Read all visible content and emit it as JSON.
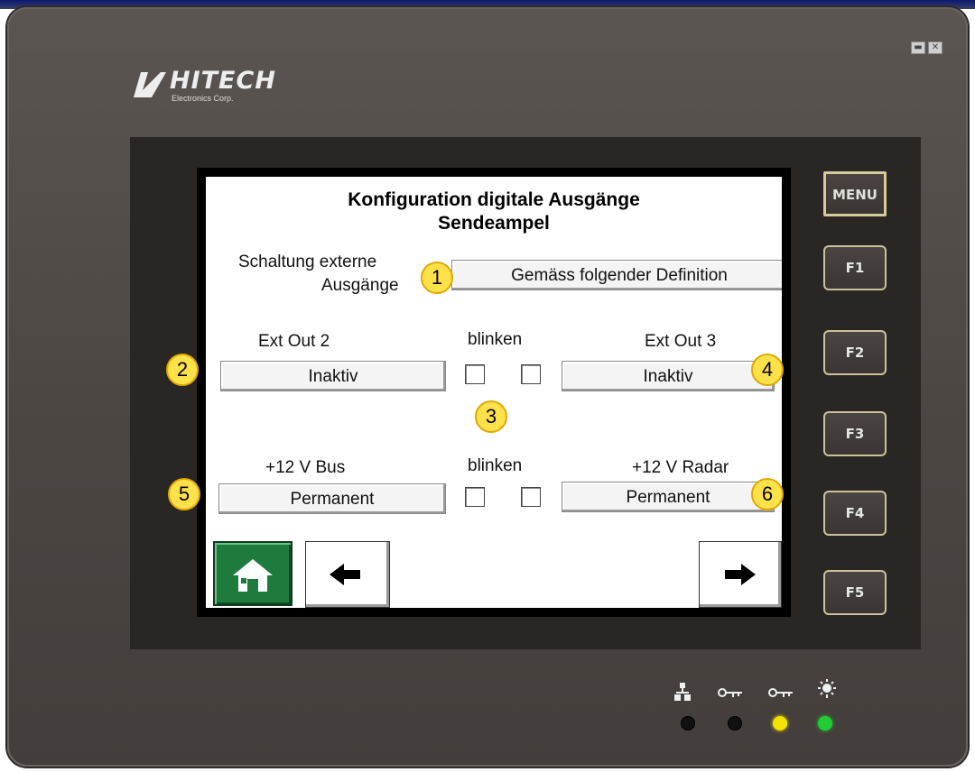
{
  "device": {
    "brand": "HITECH",
    "brand_sub": "Electronics Corp.",
    "window_controls": [
      "minimize-icon",
      "close-icon"
    ]
  },
  "screen": {
    "title_line1": "Konfiguration digitale Ausgänge",
    "title_line2": "Sendeampel",
    "circuit_label_line1": "Schaltung externe",
    "circuit_label_line2": "Ausgänge",
    "circuit_value": "Gemäss folgender Definition",
    "row1": {
      "left_label": "Ext Out 2",
      "left_value": "Inaktiv",
      "blink_label": "blinken",
      "right_label": "Ext Out 3",
      "right_value": "Inaktiv"
    },
    "row2": {
      "left_label": "+12 V Bus",
      "left_value": "Permanent",
      "blink_label": "blinken",
      "right_label": "+12 V Radar",
      "right_value": "Permanent"
    },
    "nav": {
      "home_icon": "home-icon",
      "back_icon": "arrow-left-icon",
      "next_icon": "arrow-right-icon"
    }
  },
  "function_keys": [
    "MENU",
    "F1",
    "F2",
    "F3",
    "F4",
    "F5"
  ],
  "annotations": [
    "1",
    "2",
    "3",
    "4",
    "5",
    "6"
  ],
  "leds": [
    {
      "icon": "network-icon",
      "color": "#111111"
    },
    {
      "icon": "key-icon",
      "color": "#111111"
    },
    {
      "icon": "key-icon",
      "color": "#f2e200"
    },
    {
      "icon": "power-icon",
      "color": "#22cc33"
    }
  ]
}
